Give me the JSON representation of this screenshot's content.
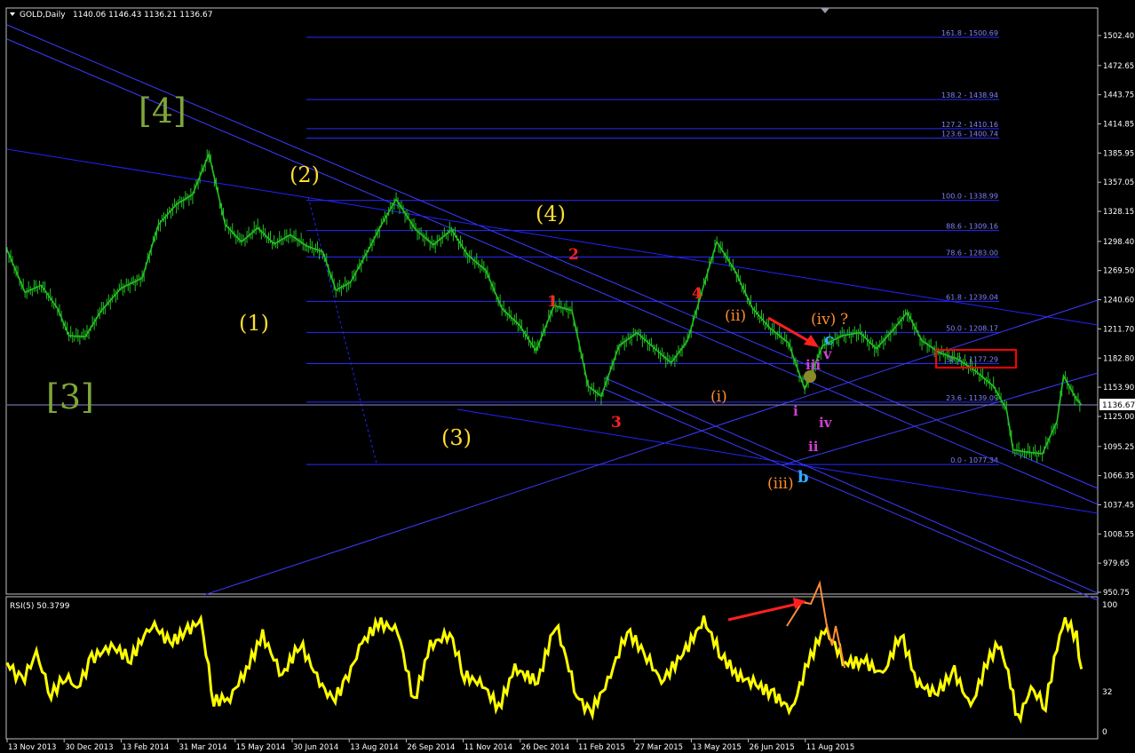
{
  "header": {
    "symbol": "GOLD,Daily",
    "ohlc": "1140.06 1146.43 1136.21 1136.67"
  },
  "current_price_label": "1136.67",
  "colors": {
    "background": "#000000",
    "price_bars": "#22c322",
    "blue_lines": "#1a1aff",
    "fib_text": "#7f7fff",
    "rsi": "#ffff00",
    "yellow_label": "#ffdd33",
    "green_label": "#7fa63a",
    "red_label": "#ff2222",
    "orange_label": "#ff8c2a",
    "magenta_label": "#d040d0",
    "cyan_label": "#33aaff"
  },
  "rsi": {
    "label": "RSI(5) 50.3799",
    "levels": [
      "100",
      "32",
      "0"
    ]
  },
  "chart_data": {
    "type": "line",
    "title": "GOLD,Daily",
    "xlabel": "",
    "ylabel": "",
    "ylim": [
      950.75,
      1515
    ],
    "y_ticks": [
      "1502.40",
      "1472.65",
      "1443.75",
      "1414.85",
      "1385.95",
      "1357.05",
      "1328.15",
      "1298.40",
      "1269.50",
      "1240.60",
      "1211.70",
      "1182.80",
      "1153.90",
      "1125.00",
      "1095.25",
      "1066.35",
      "1037.45",
      "1008.55",
      "979.65",
      "950.75"
    ],
    "x_tick_labels": [
      "13 Nov 2013",
      "30 Dec 2013",
      "13 Feb 2014",
      "31 Mar 2014",
      "15 May 2014",
      "30 Jun 2014",
      "13 Aug 2014",
      "26 Sep 2014",
      "11 Nov 2014",
      "26 Dec 2014",
      "11 Feb 2015",
      "27 Mar 2015",
      "13 May 2015",
      "26 Jun 2015",
      "11 Aug 2015"
    ],
    "x_range": [
      "2013-11-13",
      "2015-09-14"
    ],
    "price_path": [
      [
        "2013-11-13",
        1290
      ],
      [
        "2013-11-24",
        1248
      ],
      [
        "2013-12-04",
        1255
      ],
      [
        "2013-12-14",
        1232
      ],
      [
        "2013-12-21",
        1205
      ],
      [
        "2013-12-31",
        1204
      ],
      [
        "2014-01-10",
        1230
      ],
      [
        "2014-01-22",
        1252
      ],
      [
        "2014-02-04",
        1262
      ],
      [
        "2014-02-14",
        1315
      ],
      [
        "2014-02-25",
        1335
      ],
      [
        "2014-03-07",
        1345
      ],
      [
        "2014-03-17",
        1385
      ],
      [
        "2014-03-27",
        1315
      ],
      [
        "2014-04-06",
        1298
      ],
      [
        "2014-04-16",
        1312
      ],
      [
        "2014-04-26",
        1296
      ],
      [
        "2014-05-06",
        1305
      ],
      [
        "2014-05-16",
        1294
      ],
      [
        "2014-05-26",
        1288
      ],
      [
        "2014-06-03",
        1250
      ],
      [
        "2014-06-12",
        1258
      ],
      [
        "2014-06-23",
        1290
      ],
      [
        "2014-07-02",
        1318
      ],
      [
        "2014-07-10",
        1340
      ],
      [
        "2014-07-22",
        1310
      ],
      [
        "2014-08-02",
        1295
      ],
      [
        "2014-08-13",
        1310
      ],
      [
        "2014-08-23",
        1285
      ],
      [
        "2014-09-03",
        1270
      ],
      [
        "2014-09-13",
        1232
      ],
      [
        "2014-09-24",
        1215
      ],
      [
        "2014-10-04",
        1190
      ],
      [
        "2014-10-15",
        1235
      ],
      [
        "2014-10-26",
        1230
      ],
      [
        "2014-11-05",
        1155
      ],
      [
        "2014-11-13",
        1145
      ],
      [
        "2014-11-24",
        1195
      ],
      [
        "2014-12-05",
        1208
      ],
      [
        "2014-12-16",
        1192
      ],
      [
        "2014-12-26",
        1178
      ],
      [
        "2015-01-05",
        1200
      ],
      [
        "2015-01-15",
        1255
      ],
      [
        "2015-01-23",
        1298
      ],
      [
        "2015-02-03",
        1270
      ],
      [
        "2015-02-14",
        1232
      ],
      [
        "2015-02-25",
        1212
      ],
      [
        "2015-03-08",
        1198
      ],
      [
        "2015-03-18",
        1152
      ],
      [
        "2015-03-29",
        1195
      ],
      [
        "2015-04-10",
        1205
      ],
      [
        "2015-04-21",
        1208
      ],
      [
        "2015-05-01",
        1192
      ],
      [
        "2015-05-12",
        1212
      ],
      [
        "2015-05-20",
        1228
      ],
      [
        "2015-05-29",
        1200
      ],
      [
        "2015-06-09",
        1188
      ],
      [
        "2015-06-20",
        1182
      ],
      [
        "2015-07-01",
        1170
      ],
      [
        "2015-07-12",
        1155
      ],
      [
        "2015-07-20",
        1132
      ],
      [
        "2015-07-24",
        1092
      ],
      [
        "2015-07-31",
        1090
      ],
      [
        "2015-08-11",
        1088
      ],
      [
        "2015-08-20",
        1120
      ],
      [
        "2015-08-24",
        1165
      ],
      [
        "2015-09-01",
        1142
      ],
      [
        "2015-09-04",
        1136.67
      ]
    ],
    "rsi_path": [
      [
        "2013-11-13",
        55
      ],
      [
        "2013-11-22",
        40
      ],
      [
        "2013-12-01",
        62
      ],
      [
        "2013-12-10",
        30
      ],
      [
        "2013-12-19",
        45
      ],
      [
        "2013-12-26",
        35
      ],
      [
        "2014-01-04",
        58
      ],
      [
        "2014-01-16",
        68
      ],
      [
        "2014-01-28",
        58
      ],
      [
        "2014-02-10",
        86
      ],
      [
        "2014-02-21",
        70
      ],
      [
        "2014-03-04",
        80
      ],
      [
        "2014-03-12",
        88
      ],
      [
        "2014-03-20",
        25
      ],
      [
        "2014-03-30",
        28
      ],
      [
        "2014-04-09",
        50
      ],
      [
        "2014-04-19",
        76
      ],
      [
        "2014-05-01",
        45
      ],
      [
        "2014-05-12",
        70
      ],
      [
        "2014-05-24",
        40
      ],
      [
        "2014-06-01",
        25
      ],
      [
        "2014-06-09",
        40
      ],
      [
        "2014-06-19",
        70
      ],
      [
        "2014-06-29",
        86
      ],
      [
        "2014-07-11",
        80
      ],
      [
        "2014-07-21",
        25
      ],
      [
        "2014-07-31",
        68
      ],
      [
        "2014-08-12",
        78
      ],
      [
        "2014-08-21",
        45
      ],
      [
        "2014-09-01",
        38
      ],
      [
        "2014-09-11",
        20
      ],
      [
        "2014-09-21",
        50
      ],
      [
        "2014-10-05",
        40
      ],
      [
        "2014-10-16",
        86
      ],
      [
        "2014-10-29",
        30
      ],
      [
        "2014-11-06",
        15
      ],
      [
        "2014-11-17",
        40
      ],
      [
        "2014-11-29",
        80
      ],
      [
        "2014-12-11",
        60
      ],
      [
        "2014-12-20",
        40
      ],
      [
        "2015-01-04",
        65
      ],
      [
        "2015-01-15",
        88
      ],
      [
        "2015-01-26",
        60
      ],
      [
        "2015-02-05",
        45
      ],
      [
        "2015-02-16",
        38
      ],
      [
        "2015-02-27",
        30
      ],
      [
        "2015-03-10",
        18
      ],
      [
        "2015-03-20",
        55
      ],
      [
        "2015-03-30",
        82
      ],
      [
        "2015-04-12",
        55
      ],
      [
        "2015-04-25",
        55
      ],
      [
        "2015-05-05",
        45
      ],
      [
        "2015-05-16",
        78
      ],
      [
        "2015-05-26",
        40
      ],
      [
        "2015-06-06",
        30
      ],
      [
        "2015-06-18",
        48
      ],
      [
        "2015-06-28",
        20
      ],
      [
        "2015-07-08",
        55
      ],
      [
        "2015-07-15",
        70
      ],
      [
        "2015-07-21",
        48
      ],
      [
        "2015-07-27",
        10
      ],
      [
        "2015-08-04",
        35
      ],
      [
        "2015-08-13",
        22
      ],
      [
        "2015-08-20",
        68
      ],
      [
        "2015-08-25",
        88
      ],
      [
        "2015-09-01",
        75
      ],
      [
        "2015-09-04",
        50
      ]
    ],
    "fib_levels": [
      {
        "ratio": "161.8",
        "price": 1500.69,
        "label": "161.8 - 1500.69"
      },
      {
        "ratio": "138.2",
        "price": 1438.94,
        "label": "138.2 - 1438.94"
      },
      {
        "ratio": "127.2",
        "price": 1410.16,
        "label": "127.2 - 1410.16"
      },
      {
        "ratio": "123.6",
        "price": 1400.74,
        "label": "123.6 - 1400.74"
      },
      {
        "ratio": "100.0",
        "price": 1338.99,
        "label": "100.0 - 1338.99"
      },
      {
        "ratio": "88.6",
        "price": 1309.16,
        "label": "88.6 - 1309.16"
      },
      {
        "ratio": "78.6",
        "price": 1283.0,
        "label": "78.6 - 1283.00"
      },
      {
        "ratio": "61.8",
        "price": 1239.04,
        "label": "61.8 - 1239.04"
      },
      {
        "ratio": "50.0",
        "price": 1208.17,
        "label": "50.0 - 1208.17"
      },
      {
        "ratio": "38.2",
        "price": 1177.29,
        "label": "38.2 - 1177.29"
      },
      {
        "ratio": "23.6",
        "price": 1139.09,
        "label": "23.6 - 1139.09"
      },
      {
        "ratio": "0.0",
        "price": 1077.34,
        "label": "0.0 - 1077.34"
      }
    ],
    "wave_labels": [
      {
        "text": "[4]",
        "color": "green"
      },
      {
        "text": "[3]",
        "color": "green"
      },
      {
        "text": "(2)",
        "color": "yellow"
      },
      {
        "text": "(1)",
        "color": "yellow"
      },
      {
        "text": "(4)",
        "color": "yellow"
      },
      {
        "text": "(3)",
        "color": "yellow"
      },
      {
        "text": "1",
        "color": "red"
      },
      {
        "text": "2",
        "color": "red"
      },
      {
        "text": "3",
        "color": "red"
      },
      {
        "text": "4",
        "color": "red"
      },
      {
        "text": "(ii)",
        "color": "orange"
      },
      {
        "text": "(i)",
        "color": "orange"
      },
      {
        "text": "(iii)",
        "color": "orange"
      },
      {
        "text": "(iv)",
        "color": "orange"
      },
      {
        "text": "?",
        "color": "orange"
      },
      {
        "text": "c",
        "color": "cyan"
      },
      {
        "text": "b",
        "color": "cyan"
      },
      {
        "text": "v",
        "color": "magenta"
      },
      {
        "text": "iii",
        "color": "magenta"
      },
      {
        "text": "i",
        "color": "magenta"
      },
      {
        "text": "iv",
        "color": "magenta"
      },
      {
        "text": "ii",
        "color": "magenta"
      }
    ],
    "highlight_box_label": "38.2 - 1177.29"
  }
}
